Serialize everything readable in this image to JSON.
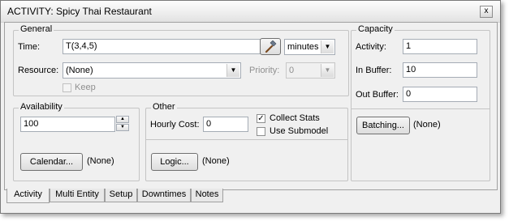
{
  "window": {
    "title": "ACTIVITY: Spicy Thai Restaurant",
    "close_glyph": "x"
  },
  "general": {
    "legend": "General",
    "time_label": "Time:",
    "time_value": "T(3,4,5)",
    "time_unit": "minutes",
    "resource_label": "Resource:",
    "resource_value": "(None)",
    "priority_label": "Priority:",
    "priority_value": "0",
    "keep_label": "Keep",
    "keep_checked": false
  },
  "availability": {
    "legend": "Availability",
    "value": "100",
    "calendar_button": "Calendar...",
    "calendar_value": "(None)"
  },
  "other": {
    "legend": "Other",
    "hourly_cost_label": "Hourly Cost:",
    "hourly_cost_value": "0",
    "collect_stats_label": "Collect Stats",
    "collect_stats_checked": true,
    "collect_stats_mark": "✓",
    "use_submodel_label": "Use Submodel",
    "use_submodel_checked": false,
    "logic_button": "Logic...",
    "logic_value": "(None)"
  },
  "capacity": {
    "legend": "Capacity",
    "activity_label": "Activity:",
    "activity_value": "1",
    "in_buffer_label": "In Buffer:",
    "in_buffer_value": "10",
    "out_buffer_label": "Out Buffer:",
    "out_buffer_value": "0",
    "batching_button": "Batching...",
    "batching_value": "(None)"
  },
  "tabs": [
    "Activity",
    "Multi Entity",
    "Setup",
    "Downtimes",
    "Notes"
  ],
  "active_tab": "Activity",
  "icons": {
    "expression_builder": "hammer-icon"
  }
}
